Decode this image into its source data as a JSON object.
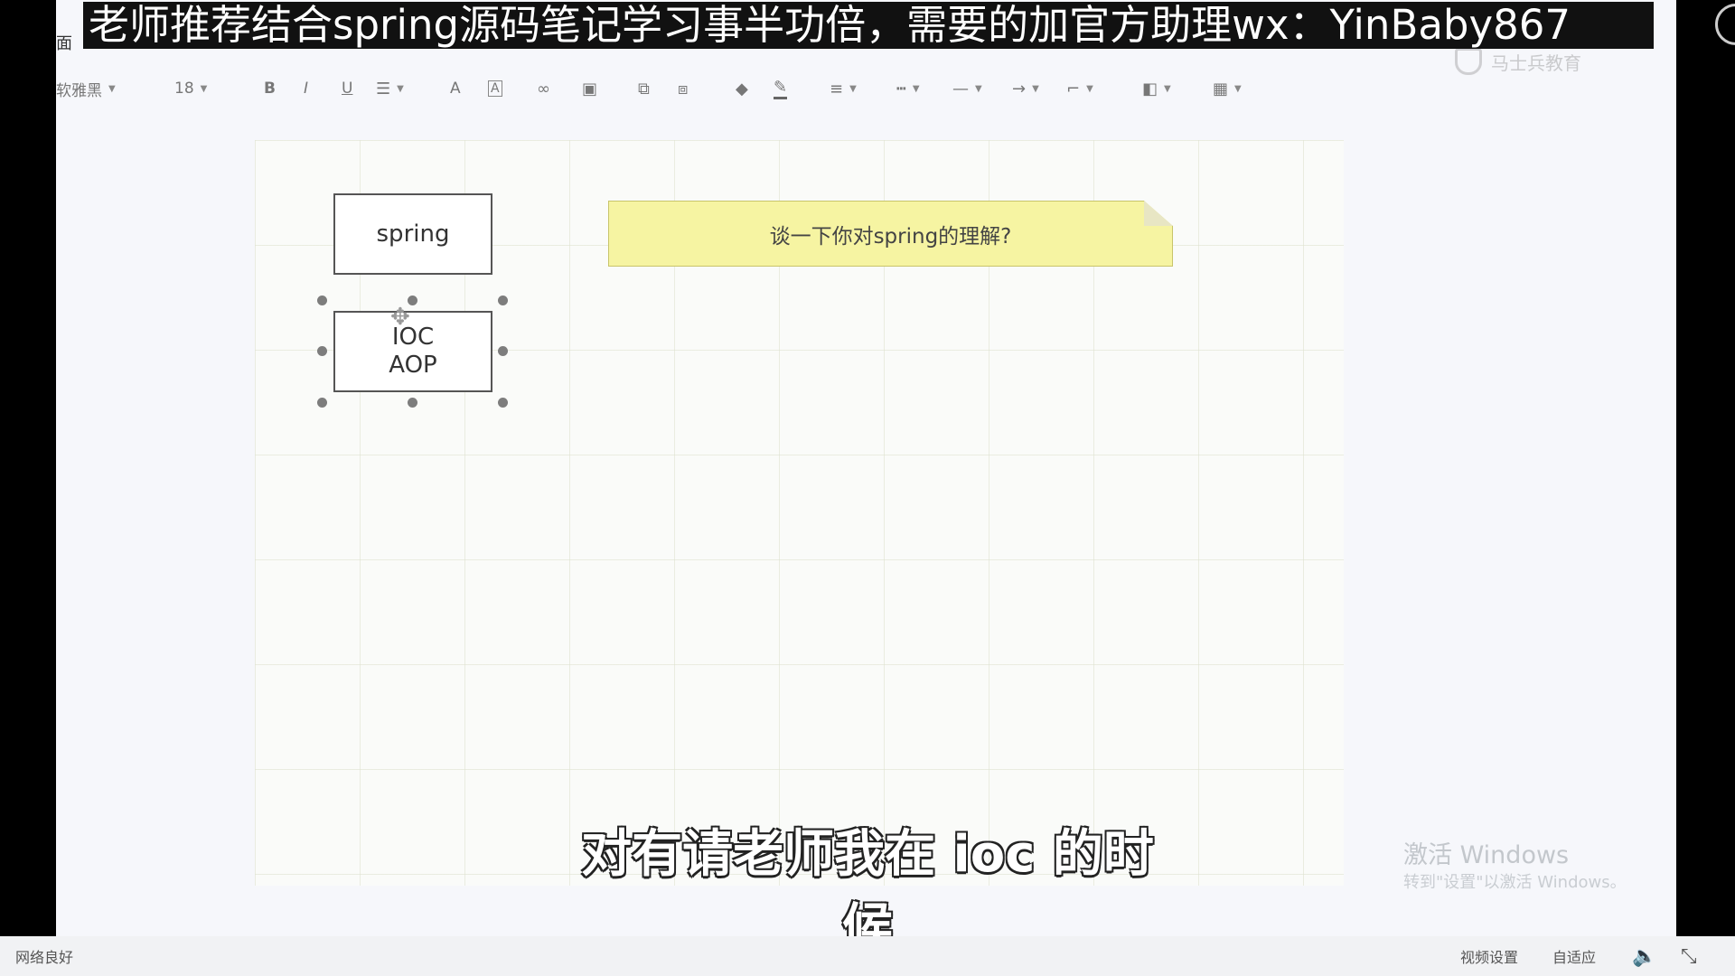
{
  "banner": {
    "text": "老师推荐结合spring源码笔记学习事半功倍，需要的加官方助理wx：YinBaby867"
  },
  "menu_fragment": "面",
  "watermark_logo": {
    "text": "马士兵教育"
  },
  "toolbar": {
    "font_family": "软雅黑",
    "font_size": "18",
    "bold_label": "B",
    "italic_label": "I",
    "underline_label": "U",
    "font_color_label": "A",
    "highlight_label": "A",
    "icons": [
      "align-icon",
      "link-icon",
      "image-icon",
      "group-icon",
      "ungroup-icon",
      "fill-icon",
      "line-color-icon",
      "line-weight-icon",
      "line-dash-icon",
      "line-style-icon",
      "arrow-icon",
      "connector-icon",
      "layer-icon",
      "table-icon"
    ]
  },
  "canvas": {
    "spring_box": "spring",
    "ioc_box": {
      "line1": "IOC",
      "line2": "AOP"
    },
    "note": "谈一下你对spring的理解?"
  },
  "subtitle": "对有请老师我在 ioc 的时候",
  "windows_watermark": {
    "title": "激活 Windows",
    "subtitle": "转到\"设置\"以激活 Windows。"
  },
  "bottom_bar": {
    "network_status": "网络良好",
    "video_settings": "视频设置",
    "auto_fit": "自适应"
  }
}
